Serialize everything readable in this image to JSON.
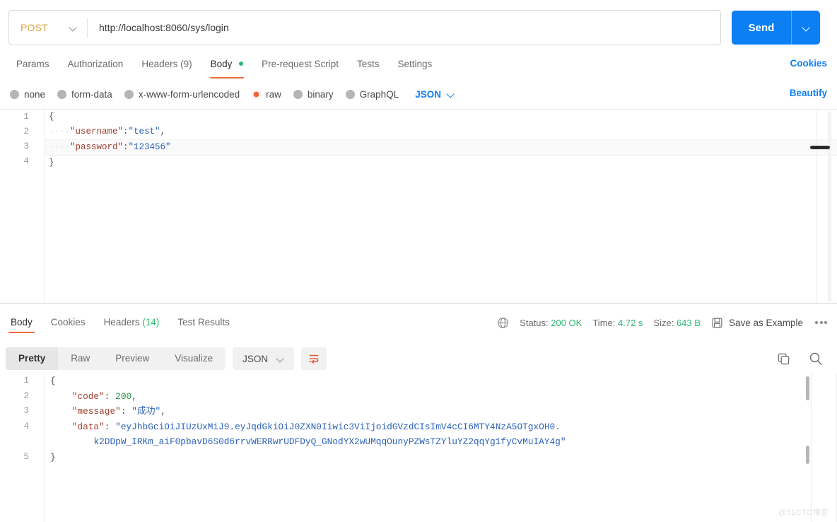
{
  "request": {
    "method": "POST",
    "url": "http://localhost:8060/sys/login",
    "send_label": "Send",
    "tabs": [
      {
        "label": "Params",
        "active": false
      },
      {
        "label": "Authorization",
        "active": false
      },
      {
        "label": "Headers (9)",
        "active": false
      },
      {
        "label": "Body",
        "active": true,
        "dot": true
      },
      {
        "label": "Pre-request Script",
        "active": false
      },
      {
        "label": "Tests",
        "active": false
      },
      {
        "label": "Settings",
        "active": false
      }
    ],
    "cookies_link": "Cookies",
    "beautify_link": "Beautify",
    "body_types": [
      {
        "label": "none",
        "selected": false
      },
      {
        "label": "form-data",
        "selected": false
      },
      {
        "label": "x-www-form-urlencoded",
        "selected": false
      },
      {
        "label": "raw",
        "selected": true
      },
      {
        "label": "binary",
        "selected": false
      },
      {
        "label": "GraphQL",
        "selected": false
      }
    ],
    "raw_format": "JSON",
    "editor": {
      "line_numbers": [
        "1",
        "2",
        "3",
        "4"
      ],
      "lines": [
        "{",
        "    \"username\":\"test\",",
        "    \"password\":\"123456\"",
        "}"
      ],
      "body_json": {
        "username": "test",
        "password": "123456"
      }
    }
  },
  "response": {
    "tabs": [
      {
        "label": "Body",
        "active": true
      },
      {
        "label": "Cookies",
        "active": false
      },
      {
        "label": "Headers (14)",
        "active": false,
        "count": "(14)"
      },
      {
        "label": "Test Results",
        "active": false
      }
    ],
    "meta": {
      "status_label": "Status:",
      "status_value": "200 OK",
      "time_label": "Time:",
      "time_value": "4.72 s",
      "size_label": "Size:",
      "size_value": "643 B",
      "save_as_example": "Save as Example"
    },
    "view_modes": [
      {
        "label": "Pretty",
        "active": true
      },
      {
        "label": "Raw",
        "active": false
      },
      {
        "label": "Preview",
        "active": false
      },
      {
        "label": "Visualize",
        "active": false
      }
    ],
    "format": "JSON",
    "body": {
      "line_numbers": [
        "1",
        "2",
        "3",
        "4",
        "5"
      ],
      "json": {
        "code": 200,
        "message": "成功",
        "data": "eyJhbGciOiJIUzUxMiJ9.eyJqdGkiOiJ0ZXN0Iiwic3ViIjoidGVzdCIsImV4cCI6MTY4NzA5OTgxOH0.k2DDpW_IRKm_aiF0pbavD6S0d6rrvWERRwrUDFDyQ_GNodYX2wUMqqOunyPZWsTZYluYZ2qqYg1fyCvMuIAY4g"
      },
      "token_line1": "eyJhbGciOiJIUzUxMiJ9.eyJqdGkiOiJ0ZXN0Iiwic3ViIjoidGVzdCIsImV4cCI6MTY4NzA5OTgxOH0.",
      "token_line2": "k2DDpW_IRKm_aiF0pbavD6S0d6rrvWERRwrUDFDyQ_GNodYX2wUMqqOunyPZWsTZYluYZ2qqYg1fyCvMuIAY4g"
    }
  },
  "watermark": "@51CTO博客",
  "colors": {
    "accent_blue": "#0d7ff5",
    "accent_orange": "#f26b3a",
    "status_green": "#2bb673",
    "method_amber": "#d9a440",
    "json_key": "#a2402f",
    "json_string": "#2c62b8",
    "json_number": "#2a8a4a"
  }
}
